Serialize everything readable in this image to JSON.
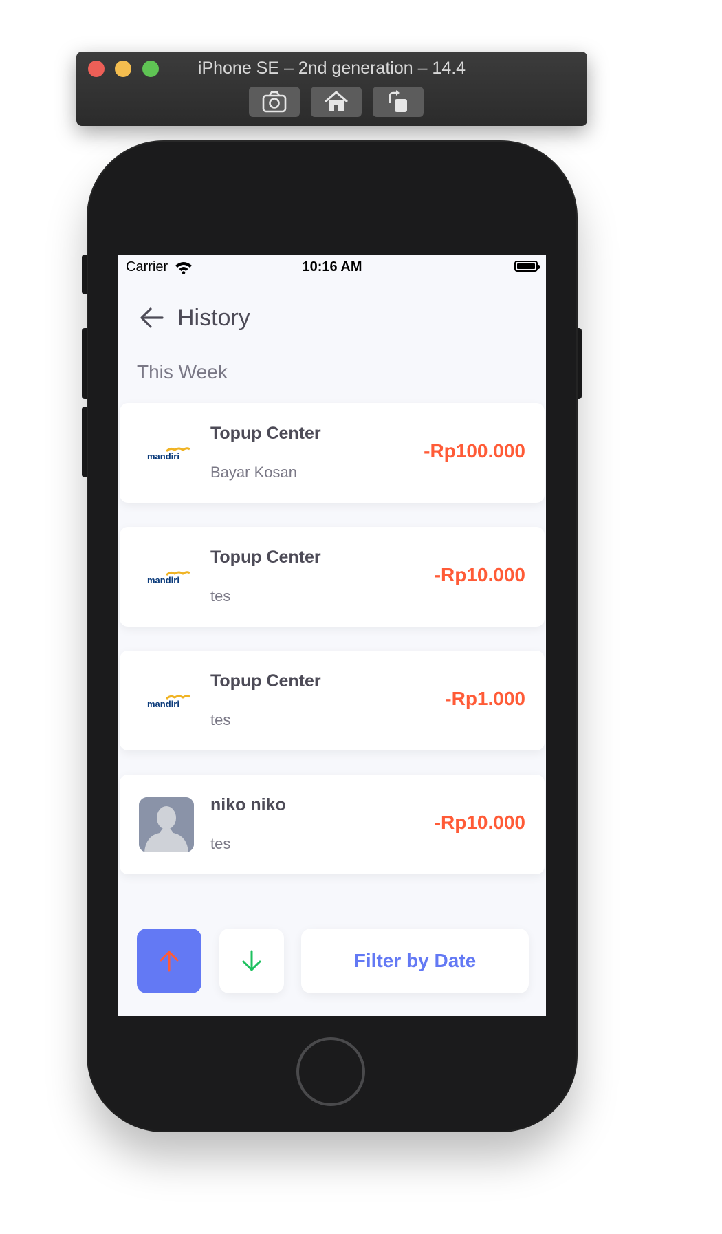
{
  "simulator": {
    "title": "iPhone SE – 2nd generation – 14.4",
    "buttons": [
      "screenshot-icon",
      "home-icon",
      "rotate-icon"
    ]
  },
  "status_bar": {
    "carrier": "Carrier",
    "time": "10:16 AM"
  },
  "header": {
    "title": "History"
  },
  "section": {
    "label": "This Week"
  },
  "transactions": [
    {
      "name": "Topup Center",
      "note": "Bayar Kosan",
      "amount": "-Rp100.000",
      "logo_text": "mandiri"
    },
    {
      "name": "Topup Center",
      "note": "tes",
      "amount": "-Rp10.000",
      "logo_text": "mandiri"
    },
    {
      "name": "Topup Center",
      "note": "tes",
      "amount": "-Rp1.000",
      "logo_text": "mandiri"
    },
    {
      "name": "niko niko",
      "note": "tes",
      "amount": "-Rp10.000"
    }
  ],
  "footer": {
    "filter_label": "Filter by Date"
  },
  "colors": {
    "accent": "#6379f4",
    "expense": "#ff5b37",
    "income": "#1ec15f",
    "background": "#f7f8fc"
  }
}
